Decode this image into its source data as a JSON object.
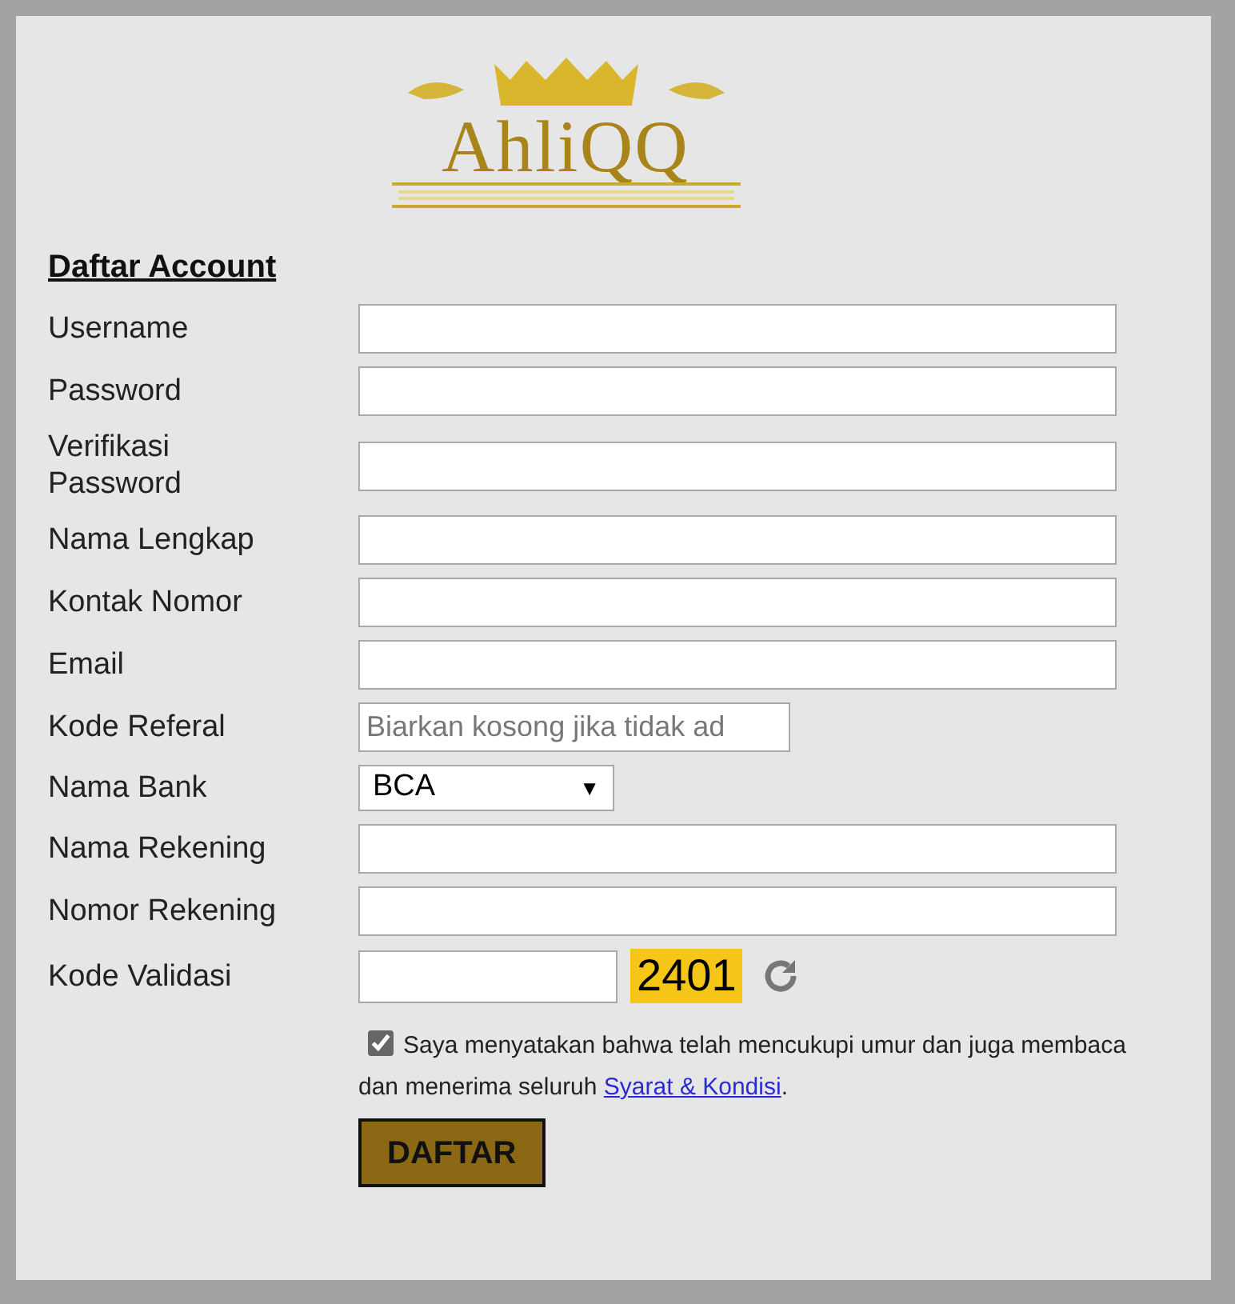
{
  "logo": {
    "text": "AhliQQ"
  },
  "heading": "Daftar Account",
  "fields": [
    {
      "kind": "text",
      "label": "Username"
    },
    {
      "kind": "text",
      "label": "Password"
    },
    {
      "kind": "text",
      "label": "Verifikasi Password"
    },
    {
      "kind": "text",
      "label": "Nama Lengkap"
    },
    {
      "kind": "text",
      "label": "Kontak Nomor"
    },
    {
      "kind": "text",
      "label": "Email"
    },
    {
      "kind": "short",
      "label": "Kode Referal",
      "placeholder": "Biarkan kosong jika tidak ad"
    },
    {
      "kind": "select",
      "label": "Nama Bank",
      "value": "BCA",
      "arrow": "▼"
    },
    {
      "kind": "text",
      "label": "Nama Rekening"
    },
    {
      "kind": "text",
      "label": "Nomor Rekening"
    },
    {
      "kind": "captcha",
      "label": "Kode Validasi",
      "code": "2401"
    }
  ],
  "agreement": {
    "checked": true,
    "text": "Saya menyatakan bahwa telah mencukupi umur dan juga membaca dan menerima seluruh",
    "link": "Syarat & Kondisi",
    "end": "."
  },
  "submit": "DAFTAR"
}
